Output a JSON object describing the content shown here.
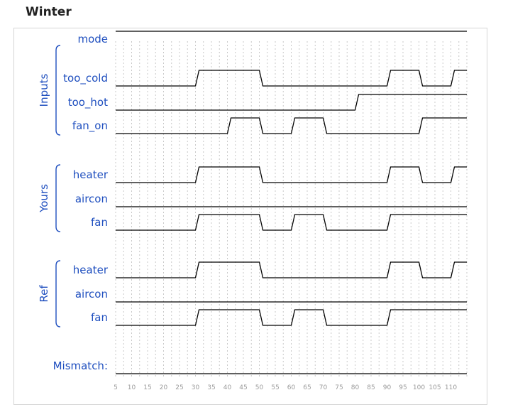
{
  "title": "Winter",
  "time_axis": {
    "start": 5,
    "end": 115,
    "ticks": [
      5,
      10,
      15,
      20,
      25,
      30,
      35,
      40,
      45,
      50,
      55,
      60,
      65,
      70,
      75,
      80,
      85,
      90,
      95,
      100,
      105,
      110
    ],
    "grid_step": 2.5
  },
  "groups": [
    {
      "name": "Inputs",
      "signals": [
        {
          "label": "mode",
          "init": 1,
          "changes": []
        },
        {
          "label": "too_cold",
          "init": 0,
          "changes": [
            [
              30,
              1
            ],
            [
              50,
              0
            ],
            [
              90,
              1
            ],
            [
              100,
              0
            ],
            [
              110,
              1
            ]
          ]
        },
        {
          "label": "too_hot",
          "init": 0,
          "changes": [
            [
              80,
              1
            ]
          ]
        },
        {
          "label": "fan_on",
          "init": 0,
          "changes": [
            [
              40,
              1
            ],
            [
              50,
              0
            ],
            [
              60,
              1
            ],
            [
              70,
              0
            ],
            [
              100,
              1
            ]
          ]
        }
      ]
    },
    {
      "name": "Yours",
      "signals": [
        {
          "label": "heater",
          "init": 0,
          "changes": [
            [
              30,
              1
            ],
            [
              50,
              0
            ],
            [
              90,
              1
            ],
            [
              100,
              0
            ],
            [
              110,
              1
            ]
          ]
        },
        {
          "label": "aircon",
          "init": 0,
          "changes": []
        },
        {
          "label": "fan",
          "init": 0,
          "changes": [
            [
              30,
              1
            ],
            [
              50,
              0
            ],
            [
              60,
              1
            ],
            [
              70,
              0
            ],
            [
              90,
              1
            ]
          ]
        }
      ]
    },
    {
      "name": "Ref",
      "signals": [
        {
          "label": "heater",
          "init": 0,
          "changes": [
            [
              30,
              1
            ],
            [
              50,
              0
            ],
            [
              90,
              1
            ],
            [
              100,
              0
            ],
            [
              110,
              1
            ]
          ]
        },
        {
          "label": "aircon",
          "init": 0,
          "changes": []
        },
        {
          "label": "fan",
          "init": 0,
          "changes": [
            [
              30,
              1
            ],
            [
              50,
              0
            ],
            [
              60,
              1
            ],
            [
              70,
              0
            ],
            [
              90,
              1
            ]
          ]
        }
      ]
    }
  ],
  "mismatch": {
    "label": "Mismatch:",
    "init": 0,
    "changes": []
  }
}
